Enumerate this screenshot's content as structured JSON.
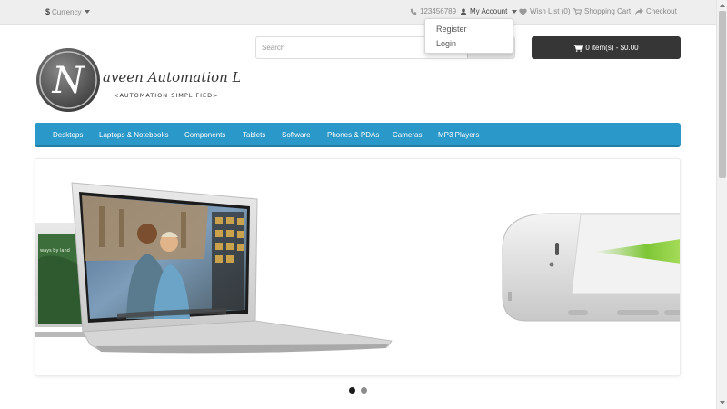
{
  "topbar": {
    "currency_symbol": "$",
    "currency_label": "Currency",
    "phone": "123456789",
    "my_account": "My Account",
    "wish_list": "Wish List (0)",
    "shopping_cart": "Shopping Cart",
    "checkout": "Checkout"
  },
  "account_menu": {
    "items": [
      "Register",
      "Login"
    ]
  },
  "logo": {
    "letter": "N",
    "title": "aveen Automation Labs",
    "tagline": "<AUTOMATION SIMPLIFIED>"
  },
  "search": {
    "placeholder": "Search",
    "value": ""
  },
  "cart": {
    "label": "0 item(s) - $0.00"
  },
  "nav": {
    "items": [
      "Desktops",
      "Laptops & Notebooks",
      "Components",
      "Tablets",
      "Software",
      "Phones & PDAs",
      "Cameras",
      "MP3 Players"
    ]
  },
  "slider": {
    "laptop_screen_label": "MacBook Air",
    "slide_count": 2,
    "active_slide": 1
  },
  "colors": {
    "nav_bg": "#2a98c8",
    "cart_bg": "#363636",
    "topbar_bg": "#eeeeee",
    "dot_active": "#1a1a1a",
    "dot_inactive": "#8c8c8c"
  }
}
